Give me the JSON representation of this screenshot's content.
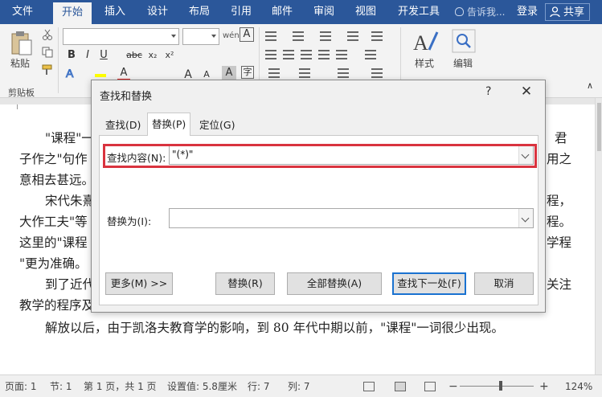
{
  "tabs": [
    "文件",
    "开始",
    "插入",
    "设计",
    "布局",
    "引用",
    "邮件",
    "审阅",
    "视图",
    "开发工具"
  ],
  "tell_me": "告诉我...",
  "login": "登录",
  "share": "共享",
  "ribbon": {
    "paste_label": "粘贴",
    "clipboard_label": "剪贴板",
    "bold": "B",
    "italic": "I",
    "underline": "U",
    "strike": "abc",
    "subscript": "x₂",
    "superscript": "x²",
    "styles_label": "样式",
    "edit_label": "编辑",
    "font_color_glyph": "A"
  },
  "document": {
    "lines": [
      "\"课程\"一",
      "子作之\"句作",
      "意相去甚远。",
      "宋代朱熹",
      "大作工夫\"等",
      "这里的\"课程",
      "\"更为准确。",
      "到了近代",
      "教学的程序及",
      "解放以后，由于凯洛夫教育学的影响，到 80 年代中期以前，\"课程\"一词很少出现。"
    ],
    "right_fragments": [
      "君",
      "用之",
      "程，",
      "程。",
      "学程",
      "关注"
    ]
  },
  "dialog": {
    "title": "查找和替换",
    "help": "?",
    "close": "✕",
    "tabs": [
      "查找(D)",
      "替换(P)",
      "定位(G)"
    ],
    "find_label": "查找内容(N):",
    "find_value": "\"(*)\"",
    "replace_label": "替换为(I):",
    "replace_value": "",
    "buttons": {
      "more": "更多(M) >>",
      "replace": "替换(R)",
      "replace_all": "全部替换(A)",
      "find_next": "查找下一处(F)",
      "cancel": "取消"
    },
    "highlight_color": "#d9333f"
  },
  "status": {
    "page": "页面: 1",
    "section": "节: 1",
    "pages": "第 1 页，共 1 页",
    "position": "设置值: 5.8厘米",
    "row": "行: 7",
    "col": "列: 7",
    "zoom_minus": "−",
    "zoom_plus": "+",
    "zoom": "124%"
  },
  "colors": {
    "accent": "#2b579a",
    "highlight": "#d9333f",
    "default_button": "#1a72d0"
  }
}
